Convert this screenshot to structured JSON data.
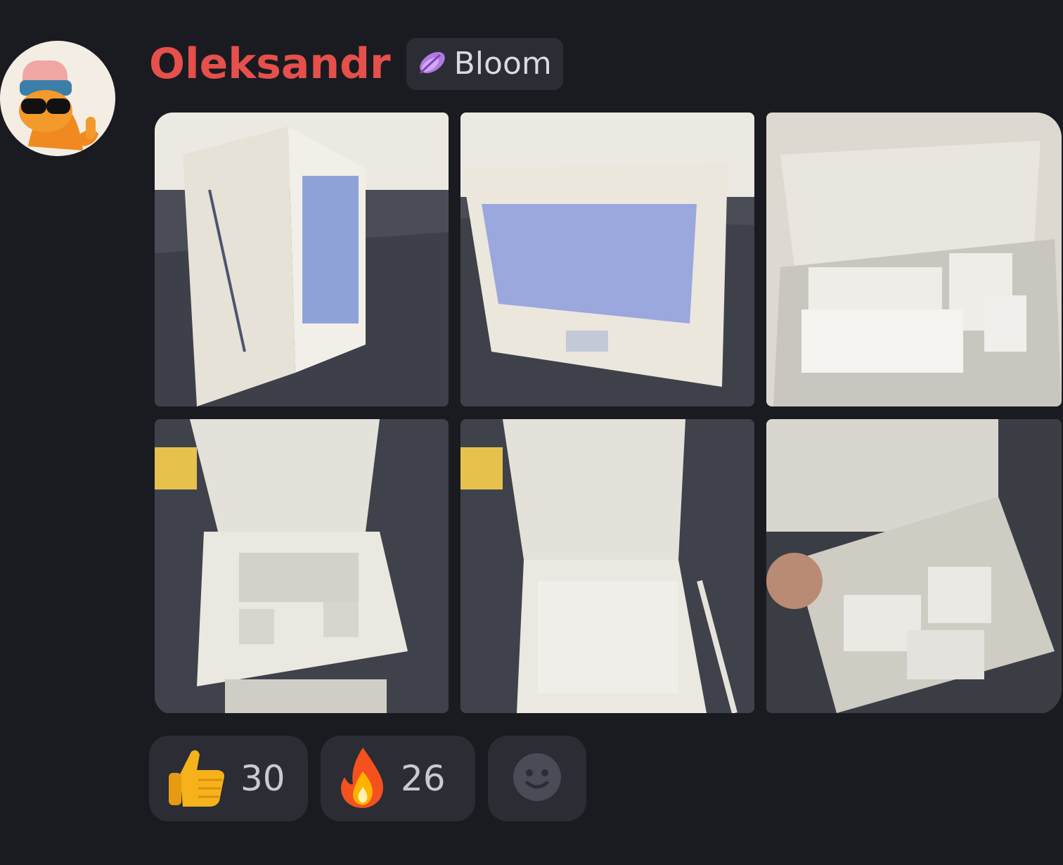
{
  "message": {
    "author": {
      "name": "Oleksandr",
      "badge": "Bloom",
      "badge_icon": "purple-flower-icon"
    },
    "attachments": [
      {
        "type": "photo",
        "depicts": "closed-box-side"
      },
      {
        "type": "photo",
        "depicts": "closed-box-front"
      },
      {
        "type": "photo",
        "depicts": "open-box-accessories"
      },
      {
        "type": "photo",
        "depicts": "open-box-top"
      },
      {
        "type": "photo",
        "depicts": "open-box-empty"
      },
      {
        "type": "photo",
        "depicts": "open-box-accessories-hand"
      }
    ],
    "reactions": [
      {
        "emoji": "thumbs-up-icon",
        "count": "30"
      },
      {
        "emoji": "fire-icon",
        "count": "26"
      }
    ],
    "add_reaction_icon": "smiley-add-icon"
  },
  "colors": {
    "background": "#1a1b20",
    "author": "#e5504c",
    "chip": "#2b2c34"
  }
}
